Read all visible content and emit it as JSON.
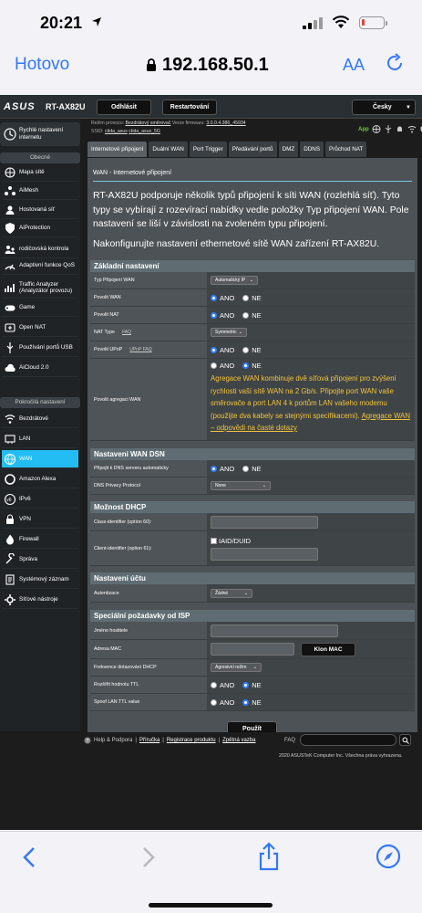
{
  "status_bar": {
    "time": "20:21"
  },
  "safari": {
    "done_label": "Hotovo",
    "url": "192.168.50.1",
    "aa_label": "AA"
  },
  "router": {
    "brand": "ASUS",
    "model": "RT-AX82U",
    "logout_label": "Odhlásit",
    "reboot_label": "Restartování",
    "language": "Česky",
    "mode_label": "Režim provozu:",
    "mode_value": "Bezdrátový směrovač",
    "firmware_label": "Verze firmwaru:",
    "firmware_value": "3.0.0.4.386_45934",
    "ssid_label": "SSID:",
    "ssid_values": [
      "ctida_asus",
      "ctida_asus_5G"
    ],
    "app_label": "App"
  },
  "sidebar": {
    "quick_setup": "Rychlé nastavení internetu",
    "general_header": "Obecné",
    "general_items": [
      {
        "label": "Mapa sítě",
        "icon": "network-map-icon"
      },
      {
        "label": "AiMesh",
        "icon": "aimesh-icon"
      },
      {
        "label": "Hostovaná síť",
        "icon": "guest-network-icon"
      },
      {
        "label": "AiProtection",
        "icon": "aiprotection-icon"
      },
      {
        "label": "rodičovská kontrola",
        "icon": "parental-control-icon"
      },
      {
        "label": "Adaptivní funkce QoS",
        "icon": "qos-icon"
      },
      {
        "label": "Traffic Analyzer (Analyzátor provozu)",
        "icon": "traffic-analyzer-icon"
      },
      {
        "label": "Game",
        "icon": "game-icon"
      },
      {
        "label": "Open NAT",
        "icon": "open-nat-icon"
      },
      {
        "label": "Používání portů USB",
        "icon": "usb-icon"
      },
      {
        "label": "AiCloud 2.0",
        "icon": "aicloud-icon"
      }
    ],
    "advanced_header": "Pokročilá nastavení",
    "advanced_items": [
      {
        "label": "Bezdrátové",
        "icon": "wireless-icon"
      },
      {
        "label": "LAN",
        "icon": "lan-icon"
      },
      {
        "label": "WAN",
        "icon": "wan-icon"
      },
      {
        "label": "Amazon Alexa",
        "icon": "alexa-icon"
      },
      {
        "label": "IPv6",
        "icon": "ipv6-icon"
      },
      {
        "label": "VPN",
        "icon": "vpn-icon"
      },
      {
        "label": "Firewall",
        "icon": "firewall-icon"
      },
      {
        "label": "Správa",
        "icon": "administration-icon"
      },
      {
        "label": "Systémový záznam",
        "icon": "system-log-icon"
      },
      {
        "label": "Síťové nástroje",
        "icon": "network-tools-icon"
      }
    ]
  },
  "tabs": [
    "Internetové připojení",
    "Duální WAN",
    "Port Trigger",
    "Předávání portů",
    "DMZ",
    "DDNS",
    "Průchod NAT"
  ],
  "panel": {
    "title": "WAN - Internetové připojení",
    "intro": "RT-AX82U podporuje několik typů připojení k síti WAN (rozlehlá síť). Tyto typy se vybírají z rozevírací nabídky vedle položky Typ připojení WAN. Pole nastavení se liší v závislosti na zvoleném typu připojení.",
    "intro2": "Nakonfigurujte nastavení ethernetové sítě WAN zařízení RT-AX82U."
  },
  "basic": {
    "header": "Základní nastavení",
    "wan_type_label": "Typ Připojení WAN",
    "wan_type_value": "Automatický IP",
    "enable_wan_label": "Povolit WAN",
    "enable_nat_label": "Povolit NAT",
    "nat_type_label": "NAT Type",
    "nat_type_value": "Symmetric",
    "upnp_label": "Povolit UPnP",
    "upnp_faq": "UPnP FAQ",
    "agg_label": "Povolit agregaci WAN",
    "agg_note": "Agregace WAN kombinuje dvě síťová připojení pro zvýšení rychlosti vaší sítě WAN na 2 Gb/s. Připojte port WAN vaše směrovače a port LAN 4 k portům LAN vašeho modemu (použijte dva kabely se stejnými specifikacemi).",
    "agg_link": "Agregace WAN – odpovědi na časté dotazy"
  },
  "radio": {
    "yes": "ANO",
    "no": "NE"
  },
  "faq_link": "FAQ",
  "dns": {
    "header": "Nastavení WAN DSN",
    "auto_label": "Připojit k DNS serveru automaticky",
    "privacy_label": "DNS Privacy Protocol",
    "privacy_value": "None"
  },
  "dhcp": {
    "header": "Možnost DHCP",
    "class_label": "Class-identifier (option 60):",
    "client_label": "Client-identifier (option 61):",
    "iaid_label": "IAID/DUID"
  },
  "account": {
    "header": "Nastavení účtu",
    "auth_label": "Autentizace",
    "auth_value": "Žádné"
  },
  "isp": {
    "header": "Speciální požadavky od ISP",
    "hostname_label": "Jméno hostitele",
    "mac_label": "Adresa MAC",
    "clone_mac": "Klon MAC",
    "dhcp_freq_label": "Frekvence dotazování DHCP",
    "dhcp_freq_value": "Agresivní režim",
    "ttl_ext_label": "Rozšířit hodnotu TTL",
    "spoof_ttl_label": "Spoof LAN TTL value"
  },
  "apply_label": "Použít",
  "footer": {
    "help": "Help & Podpora",
    "links": [
      "Příručka",
      "Registrace produktu",
      "Zpětná vazba"
    ],
    "faq": "FAQ",
    "copyright": "2020 ASUSTeK Computer Inc. Všechna práva vyhrazena."
  },
  "colors": {
    "ios_blue": "#3478f6",
    "router_bg": "#1c1c1c",
    "active_tab": "#24bdf3",
    "note_yellow": "#f3c43a",
    "battery_red": "#e0443a"
  },
  "battery_level": 0.15
}
